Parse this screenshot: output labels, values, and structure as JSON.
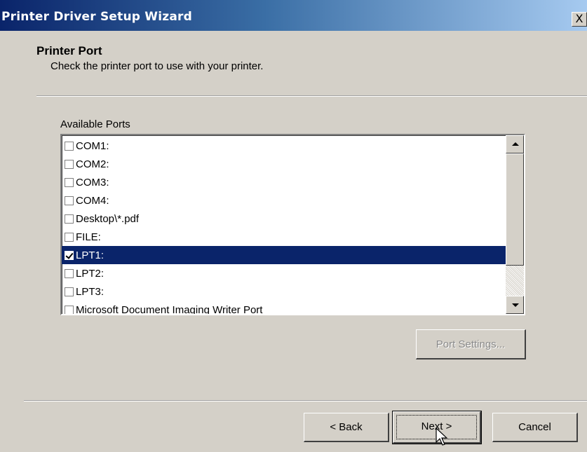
{
  "window": {
    "title": "Printer Driver Setup Wizard",
    "close_label": "X"
  },
  "header": {
    "title": "Printer Port",
    "subtitle": "Check the printer port to use with your printer."
  },
  "ports": {
    "label": "Available Ports",
    "items": [
      {
        "label": "COM1:",
        "checked": false,
        "selected": false
      },
      {
        "label": "COM2:",
        "checked": false,
        "selected": false
      },
      {
        "label": "COM3:",
        "checked": false,
        "selected": false
      },
      {
        "label": "COM4:",
        "checked": false,
        "selected": false
      },
      {
        "label": "Desktop\\*.pdf",
        "checked": false,
        "selected": false
      },
      {
        "label": "FILE:",
        "checked": false,
        "selected": false
      },
      {
        "label": "LPT1:",
        "checked": true,
        "selected": true
      },
      {
        "label": "LPT2:",
        "checked": false,
        "selected": false
      },
      {
        "label": "LPT3:",
        "checked": false,
        "selected": false
      },
      {
        "label": "Microsoft Document Imaging Writer Port",
        "checked": false,
        "selected": false
      }
    ]
  },
  "buttons": {
    "port_settings": "Port Settings...",
    "back": "< Back",
    "next": "Next >",
    "cancel": "Cancel"
  },
  "colors": {
    "title_bar_start": "#0a246a",
    "title_bar_end": "#a6caf0",
    "selection": "#0a246a",
    "face": "#d4d0c8"
  }
}
